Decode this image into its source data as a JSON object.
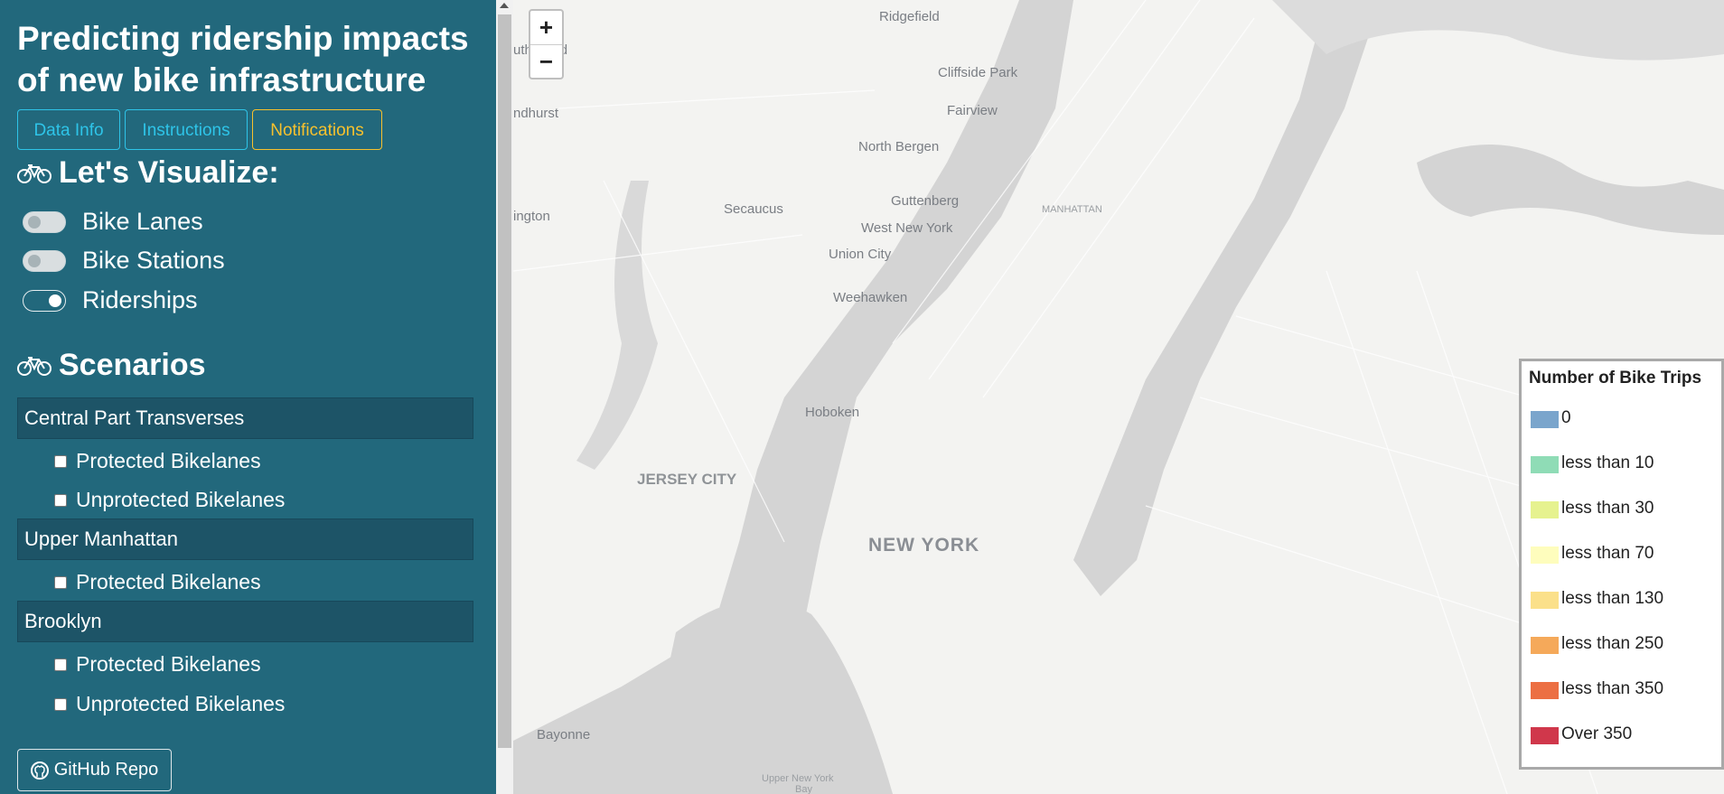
{
  "sidebar": {
    "title_line1": "Predicting ridership impacts",
    "title_line2": "of new bike infrastructure",
    "buttons": {
      "data_info": "Data Info",
      "instructions": "Instructions",
      "notifications": "Notifications"
    },
    "visualize_heading": "Let's Visualize:",
    "toggles": [
      {
        "label": "Bike Lanes",
        "on": false
      },
      {
        "label": "Bike Stations",
        "on": false
      },
      {
        "label": "Riderships",
        "on": true
      }
    ],
    "scenarios_heading": "Scenarios",
    "scenarios": [
      {
        "name": "Central Part Transverses",
        "options": [
          "Protected Bikelanes",
          "Unprotected Bikelanes"
        ]
      },
      {
        "name": "Upper Manhattan",
        "options": [
          "Protected Bikelanes"
        ]
      },
      {
        "name": "Brooklyn",
        "options": [
          "Protected Bikelanes",
          "Unprotected Bikelanes"
        ]
      }
    ],
    "github_label": "GitHub Repo"
  },
  "map": {
    "zoom_in": "+",
    "zoom_out": "−",
    "places": {
      "ridgefield": "Ridgefield",
      "rutherford": "utherford",
      "cliffside": "Cliffside Park",
      "lyndhurst": "ndhurst",
      "fairview": "Fairview",
      "north_bergen": "North Bergen",
      "secaucus": "Secaucus",
      "guttenberg": "Guttenberg",
      "manhattan": "MANHATTAN",
      "kingston": "ington",
      "west_new_york": "West New York",
      "union_city": "Union City",
      "weehawken": "Weehawken",
      "hoboken": "Hoboken",
      "jersey_city": "JERSEY CITY",
      "new_york": "NEW YORK",
      "bayonne": "Bayonne",
      "upper_ny_bay": "Upper New York",
      "upper_ny_bay2": "Bay"
    }
  },
  "legend": {
    "title": "Number of Bike Trips",
    "items": [
      {
        "label": "0",
        "color": "#7aa5cc"
      },
      {
        "label": "less than 10",
        "color": "#8fdcb6"
      },
      {
        "label": "less than 30",
        "color": "#e6f28f"
      },
      {
        "label": "less than 70",
        "color": "#fefdbd"
      },
      {
        "label": "less than 130",
        "color": "#fbe08a"
      },
      {
        "label": "less than 250",
        "color": "#f5a95a"
      },
      {
        "label": "less than 350",
        "color": "#ec6f43"
      },
      {
        "label": "Over 350",
        "color": "#d0374b"
      }
    ]
  }
}
